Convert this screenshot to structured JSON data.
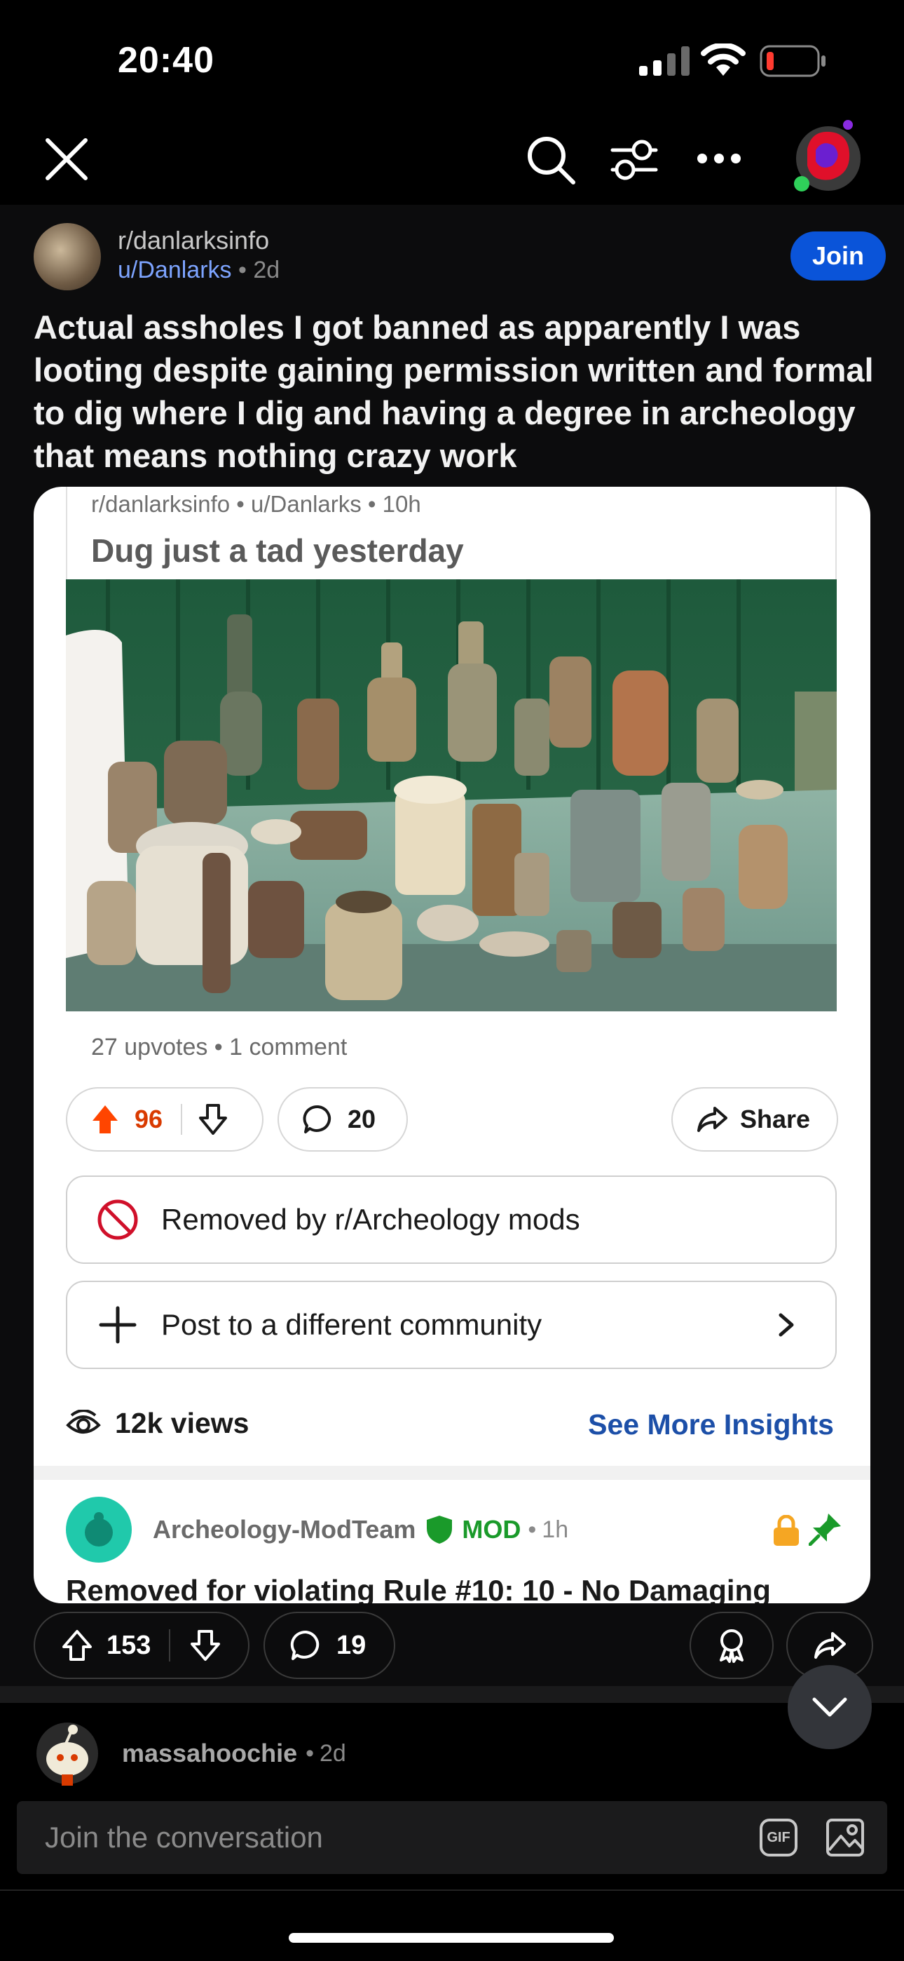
{
  "status_bar": {
    "time": "20:40"
  },
  "nav": {
    "close_icon": "close-icon",
    "search_icon": "search-icon",
    "filter_icon": "filter-icon",
    "more_icon": "more-icon",
    "avatar_icon": "avatar"
  },
  "post": {
    "subreddit": "r/danlarksinfo",
    "author": "u/Danlarks",
    "age": "2d",
    "join_label": "Join",
    "title": "Actual assholes I got banned as apparently I was looting despite gaining permission written and formal to dig where I dig and having a degree in archeology that means nothing crazy work",
    "crosspost": {
      "subreddit": "r/danlarksinfo",
      "author": "u/Danlarks",
      "age": "10h",
      "title": "Dug just a tad yesterday",
      "stats": "27 upvotes • 1 comment",
      "votes": "96",
      "comments": "20",
      "share_label": "Share",
      "removed_label": "Removed by r/Archeology mods",
      "post_elsewhere_label": "Post to a different community",
      "views": "12k views",
      "insights_label": "See More Insights",
      "mod_comment": {
        "author": "Archeology-ModTeam",
        "badge": "MOD",
        "age": "1h",
        "text": "Removed for violating Rule #10: 10 - No Damaging"
      }
    },
    "votes": "153",
    "comments": "19"
  },
  "comment_preview": {
    "author": "massahoochie",
    "age": "2d"
  },
  "reply_bar": {
    "placeholder": "Join the conversation",
    "gif_label": "GIF"
  },
  "colors": {
    "join": "#0a54d9",
    "upvote": "#ff4500",
    "mod": "#1a9a2a",
    "link": "#1c4fa8"
  }
}
